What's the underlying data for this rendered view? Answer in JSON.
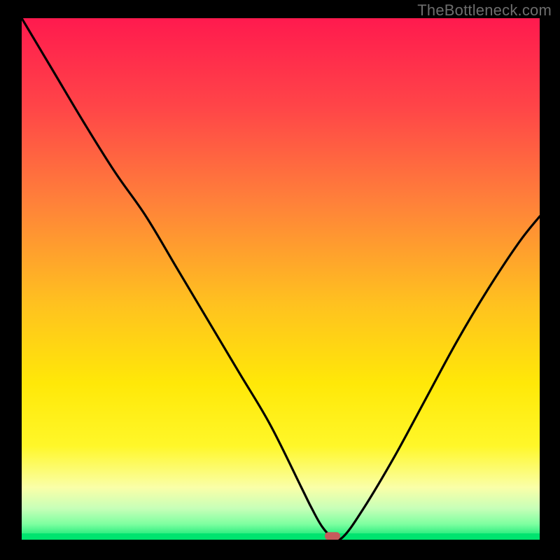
{
  "watermark": "TheBottleneck.com",
  "chart_data": {
    "type": "line",
    "title": "",
    "xlabel": "",
    "ylabel": "",
    "xlim": [
      0,
      100
    ],
    "ylim": [
      0,
      100
    ],
    "gradient_stops": [
      {
        "offset": 0,
        "color": "#ff1a4e"
      },
      {
        "offset": 17,
        "color": "#ff4548"
      },
      {
        "offset": 35,
        "color": "#ff803a"
      },
      {
        "offset": 55,
        "color": "#ffc21f"
      },
      {
        "offset": 70,
        "color": "#ffe808"
      },
      {
        "offset": 82,
        "color": "#fff729"
      },
      {
        "offset": 90,
        "color": "#faffa8"
      },
      {
        "offset": 94,
        "color": "#c7ffb8"
      },
      {
        "offset": 97,
        "color": "#7effa0"
      },
      {
        "offset": 100,
        "color": "#00e46f"
      }
    ],
    "series": [
      {
        "name": "bottleneck-curve",
        "x": [
          0,
          6,
          12,
          18,
          24,
          30,
          36,
          42,
          48,
          54,
          56,
          58,
          60,
          62,
          66,
          72,
          78,
          84,
          90,
          96,
          100
        ],
        "y": [
          100,
          90,
          80,
          70.5,
          62,
          52,
          42,
          32,
          22,
          10,
          6,
          2.5,
          0.5,
          0.5,
          6,
          16,
          27,
          38,
          48,
          57,
          62
        ]
      }
    ],
    "flat_region_x": [
      58,
      62.5
    ],
    "marker": {
      "x": 60,
      "y": 0.7
    }
  }
}
